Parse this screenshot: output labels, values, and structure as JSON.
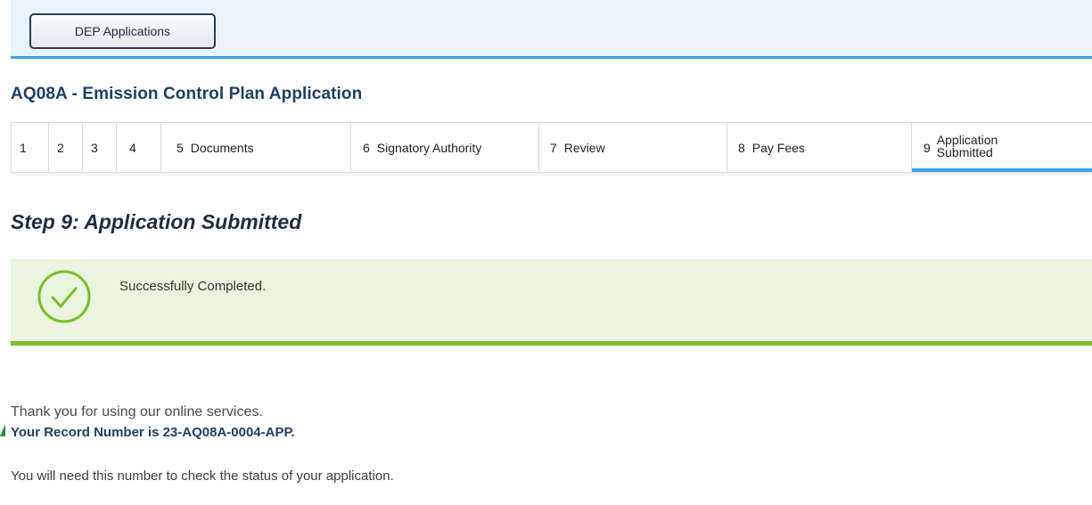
{
  "header": {
    "dep_button_label": "DEP Applications"
  },
  "application": {
    "title": "AQ08A - Emission Control Plan Application"
  },
  "steps": [
    {
      "num": "1",
      "label": ""
    },
    {
      "num": "2",
      "label": ""
    },
    {
      "num": "3",
      "label": ""
    },
    {
      "num": "4",
      "label": ""
    },
    {
      "num": "5",
      "label": "Documents"
    },
    {
      "num": "6",
      "label": "Signatory Authority"
    },
    {
      "num": "7",
      "label": "Review"
    },
    {
      "num": "8",
      "label": "Pay Fees"
    },
    {
      "num": "9",
      "label_line1": "Application",
      "label_line2": "Submitted",
      "active": true
    }
  ],
  "step_heading": "Step 9: Application Submitted",
  "success": {
    "message": "Successfully Completed.",
    "icon": "check-circle-icon",
    "color": "#78bf29",
    "background": "#eaf5df"
  },
  "confirmation": {
    "thanks": "Thank you for using our online services.",
    "record_text": "Your Record Number is 23-AQ08A-0004-APP.",
    "note": "You will need this number to check the status of your application."
  },
  "colors": {
    "accent": "#3ba6e2",
    "title": "#1d3f66",
    "header_bg": "#eaf3fb"
  }
}
